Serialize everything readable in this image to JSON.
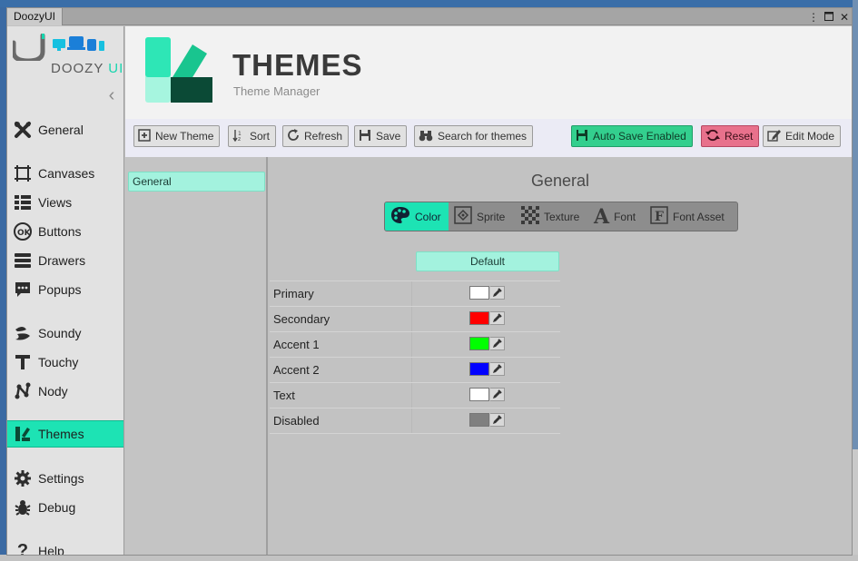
{
  "window": {
    "title": "DoozyUI"
  },
  "brand": {
    "name": "DOOZY",
    "suffix": "UI"
  },
  "sidebar": {
    "items": [
      {
        "id": "general",
        "label": "General",
        "icon": "tools-icon"
      },
      {
        "id": "canvases",
        "label": "Canvases",
        "icon": "canvas-icon"
      },
      {
        "id": "views",
        "label": "Views",
        "icon": "views-icon"
      },
      {
        "id": "buttons",
        "label": "Buttons",
        "icon": "ok-button-icon"
      },
      {
        "id": "drawers",
        "label": "Drawers",
        "icon": "drawers-icon"
      },
      {
        "id": "popups",
        "label": "Popups",
        "icon": "popup-icon"
      },
      {
        "id": "soundy",
        "label": "Soundy",
        "icon": "soundy-icon"
      },
      {
        "id": "touchy",
        "label": "Touchy",
        "icon": "touchy-icon"
      },
      {
        "id": "nody",
        "label": "Nody",
        "icon": "nody-icon"
      },
      {
        "id": "themes",
        "label": "Themes",
        "icon": "themes-icon",
        "active": true
      },
      {
        "id": "settings",
        "label": "Settings",
        "icon": "gear-icon"
      },
      {
        "id": "debug",
        "label": "Debug",
        "icon": "bug-icon"
      },
      {
        "id": "help",
        "label": "Help",
        "icon": "help-icon"
      }
    ]
  },
  "header": {
    "title": "THEMES",
    "subtitle": "Theme Manager"
  },
  "toolbar": {
    "new_theme": "New Theme",
    "sort": "Sort",
    "refresh": "Refresh",
    "save": "Save",
    "search": "Search for themes",
    "auto_save": "Auto Save Enabled",
    "reset": "Reset",
    "edit_mode": "Edit Mode"
  },
  "categories": {
    "items": [
      "General"
    ],
    "selected": "General"
  },
  "main": {
    "section_title": "General",
    "tabs": [
      {
        "label": "Color",
        "icon": "palette-icon",
        "active": true
      },
      {
        "label": "Sprite",
        "icon": "sprite-icon"
      },
      {
        "label": "Texture",
        "icon": "texture-icon"
      },
      {
        "label": "Font",
        "icon": "font-icon"
      },
      {
        "label": "Font Asset",
        "icon": "font-asset-icon"
      }
    ],
    "variant_header": "Default",
    "rows": [
      {
        "label": "Primary",
        "color": "#ffffff"
      },
      {
        "label": "Secondary",
        "color": "#ff0000"
      },
      {
        "label": "Accent 1",
        "color": "#00ff00"
      },
      {
        "label": "Accent 2",
        "color": "#0000ff"
      },
      {
        "label": "Text",
        "color": "#ffffff"
      },
      {
        "label": "Disabled",
        "color": "#808080"
      }
    ]
  },
  "colors": {
    "accent": "#1de3b4",
    "accent_light": "#a3f2de",
    "auto_save_bg": "#33cf8e",
    "reset_bg": "#e8718c",
    "logo_dark": "#0b4a36",
    "logo_mid": "#19c58f"
  }
}
